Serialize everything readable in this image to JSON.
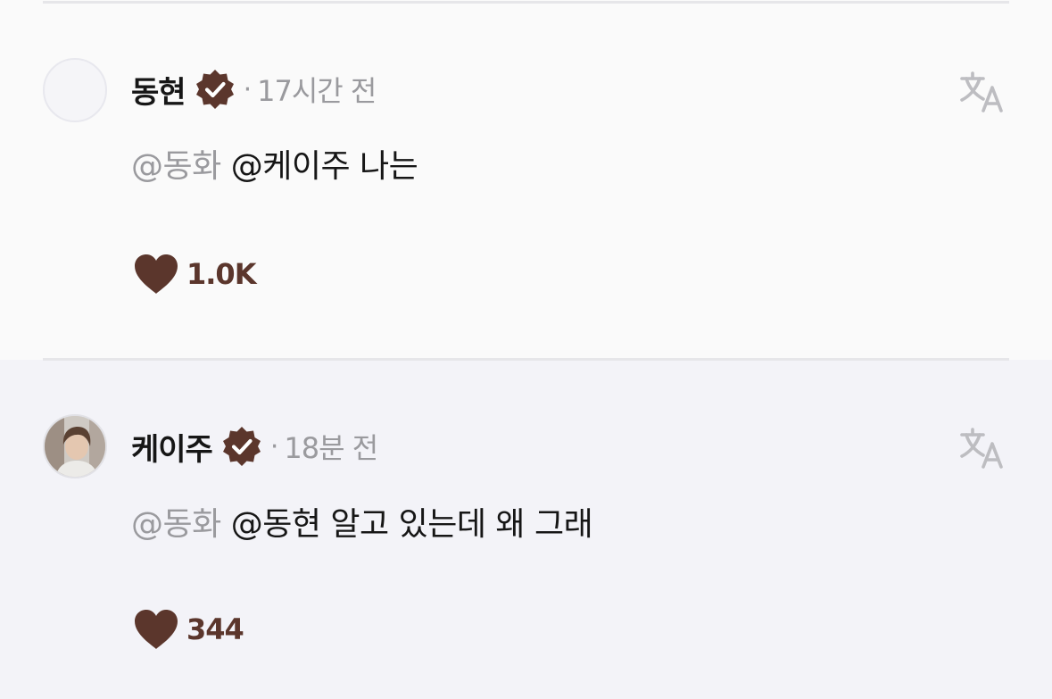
{
  "colors": {
    "brand_brown": "#5b362c",
    "muted_text": "#9a9a9e",
    "primary_text": "#161616",
    "divider": "#e6e6e9"
  },
  "comments": [
    {
      "username": "동현",
      "separator": "·",
      "time": "17시간 전",
      "mention_muted": "@동화",
      "mention_dark": "@케이주",
      "text": "나는",
      "likes": "1.0K",
      "avatar": "blank-avatar",
      "icons": [
        "verified-badge-icon",
        "translate-icon",
        "heart-icon"
      ]
    },
    {
      "username": "케이주",
      "separator": "·",
      "time": "18분 전",
      "mention_muted": "@동화",
      "mention_dark": "@동현",
      "text": "알고 있는데 왜 그래",
      "likes": "344",
      "avatar": "photo-avatar",
      "icons": [
        "verified-badge-icon",
        "translate-icon",
        "heart-icon"
      ]
    }
  ]
}
